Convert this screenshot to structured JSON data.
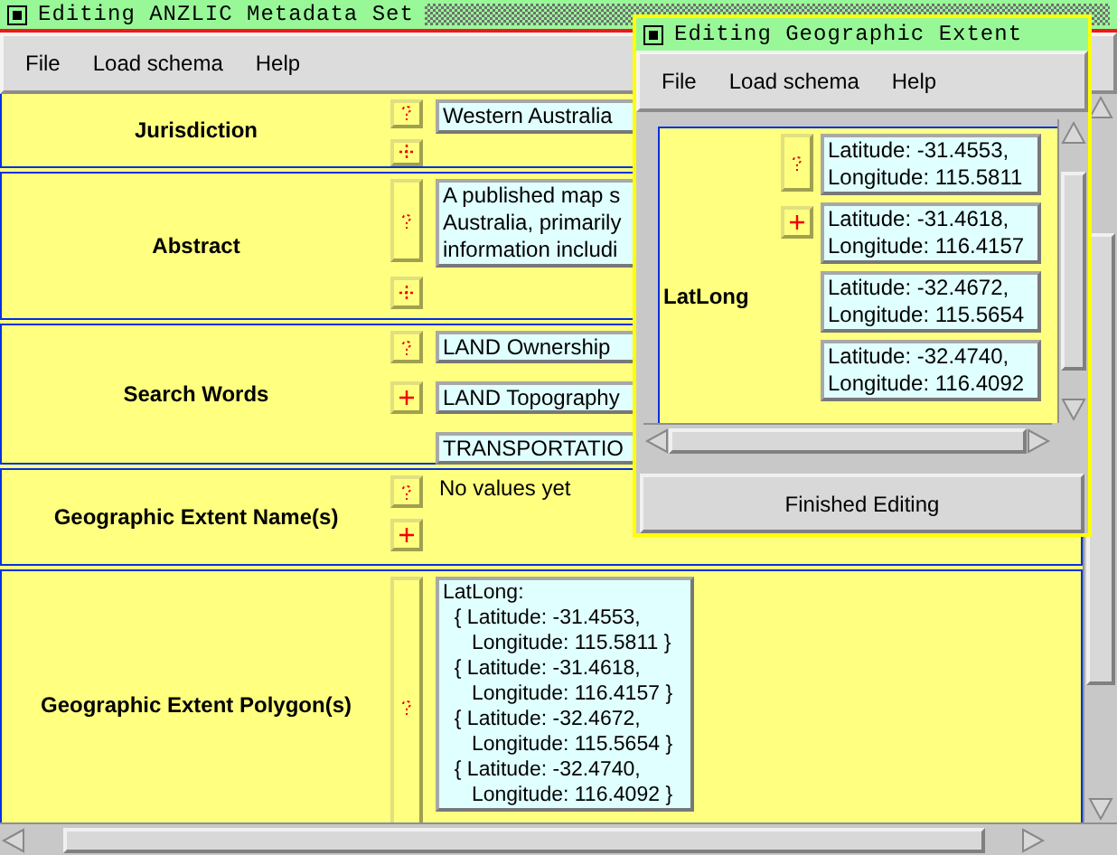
{
  "main_window": {
    "title": "Editing ANZLIC Metadata Set",
    "menu": [
      "File",
      "Load schema",
      "Help"
    ],
    "fields": [
      {
        "label": "Jurisdiction",
        "buttons": [
          {
            "kind": "help",
            "enabled": false
          },
          {
            "kind": "add",
            "enabled": false
          }
        ],
        "values": [
          "Western Australia"
        ],
        "tall_help": false
      },
      {
        "label": "Abstract",
        "buttons": [
          {
            "kind": "help",
            "enabled": false
          },
          {
            "kind": "add",
            "enabled": false
          }
        ],
        "values": [
          "A published map s\nAustralia, primarily\ninformation includi"
        ],
        "tall_help": true
      },
      {
        "label": "Search Words",
        "buttons": [
          {
            "kind": "help",
            "enabled": false
          },
          {
            "kind": "add",
            "enabled": true
          }
        ],
        "values": [
          "LAND Ownership",
          "LAND Topography",
          "TRANSPORTATIO"
        ],
        "tall_help": false
      },
      {
        "label": "Geographic Extent Name(s)",
        "buttons": [
          {
            "kind": "help",
            "enabled": false
          },
          {
            "kind": "add",
            "enabled": true
          }
        ],
        "empty_text": "No values yet",
        "tall_help": false
      },
      {
        "label": "Geographic Extent Polygon(s)",
        "buttons": [
          {
            "kind": "help",
            "enabled": false
          }
        ],
        "values": [
          "LatLong:\n  { Latitude: -31.4553,\n     Longitude: 115.5811 }\n  { Latitude: -31.4618,\n     Longitude: 116.4157 }\n  { Latitude: -32.4672,\n     Longitude: 115.5654 }\n  { Latitude: -32.4740,\n     Longitude: 116.4092 }"
        ],
        "tall_help": true
      }
    ]
  },
  "dialog": {
    "title": "Editing Geographic Extent",
    "menu": [
      "File",
      "Load schema",
      "Help"
    ],
    "field": {
      "label": "LatLong",
      "buttons": [
        {
          "kind": "help",
          "enabled": false
        },
        {
          "kind": "add",
          "enabled": true
        }
      ],
      "values": [
        "Latitude: -31.4553,\nLongitude: 115.5811",
        "Latitude: -31.4618,\nLongitude: 116.4157",
        "Latitude: -32.4672,\nLongitude: 115.5654",
        "Latitude: -32.4740,\nLongitude: 116.4092"
      ]
    },
    "button": "Finished Editing"
  }
}
